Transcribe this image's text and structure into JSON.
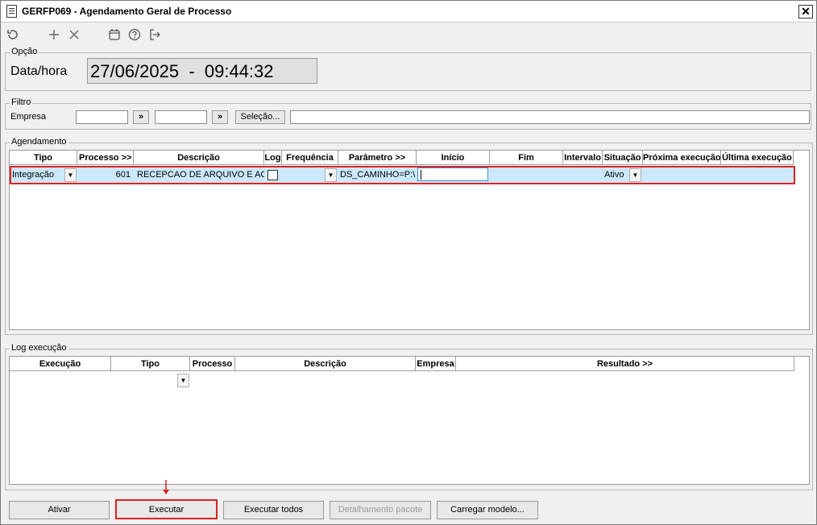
{
  "window": {
    "title": "GERFP069 - Agendamento Geral de Processo",
    "close_glyph": "✕"
  },
  "toolbar": {
    "icons": [
      "refresh-icon",
      "add-icon",
      "delete-icon",
      "calendar-icon",
      "help-icon",
      "exit-icon"
    ]
  },
  "opcao": {
    "label": "Opção",
    "datetime_label": "Data/hora",
    "datetime_value": "27/06/2025  -  09:44:32"
  },
  "filtro": {
    "label": "Filtro",
    "empresa_label": "Empresa",
    "empresa_from": "",
    "empresa_to": "",
    "lookup1": "»",
    "lookup2": "»",
    "selecao_button": "Seleção...",
    "selecao_value": ""
  },
  "agendamento": {
    "label": "Agendamento",
    "columns": [
      "Tipo",
      "Processo >>",
      "Descrição",
      "Log",
      "Frequência",
      "Parâmetro >>",
      "Início",
      "Fim",
      "Intervalo",
      "Situação",
      "Próxima execução",
      "Última execução"
    ],
    "rows": [
      {
        "tipo": "Integração",
        "processo": "601",
        "descricao": "RECEPCAO DE ARQUIVO E ACEI",
        "log": "",
        "frequencia": "",
        "parametro": "DS_CAMINHO=P:\\D(",
        "inicio": "",
        "fim": "",
        "intervalo": "",
        "situacao": "Ativo",
        "proxima": "",
        "ultima": ""
      }
    ]
  },
  "log_execucao": {
    "label": "Log execução",
    "columns": [
      "Execução",
      "Tipo",
      "Processo",
      "Descrição",
      "Empresa",
      "Resultado >>"
    ]
  },
  "buttons": {
    "ativar": "Ativar",
    "executar": "Executar",
    "executar_todos": "Executar todos",
    "detalhamento": "Detalhamento pacote",
    "carregar": "Carregar modelo..."
  },
  "colors": {
    "selection_row": "#cce8ff",
    "highlight": "#e02020"
  }
}
